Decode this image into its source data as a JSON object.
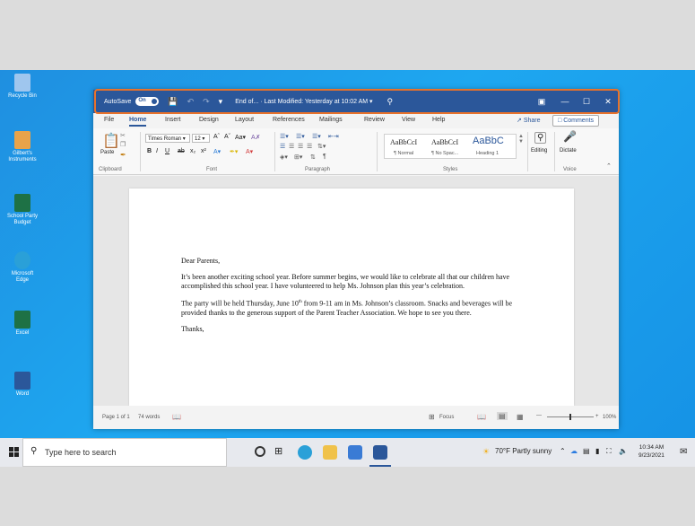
{
  "desktop": {
    "icons": [
      {
        "label": "Recycle Bin",
        "color": "#6aa7e8"
      },
      {
        "label": "Gilbert's Instruments",
        "color": "#e8a34a"
      },
      {
        "label": "School Party Budget",
        "color": "#1e7145"
      },
      {
        "label": "Microsoft Edge",
        "color": "#2aa0d8"
      },
      {
        "label": "Excel",
        "color": "#1e7145"
      },
      {
        "label": "Word",
        "color": "#2b579a"
      }
    ]
  },
  "titlebar": {
    "autosave": "AutoSave",
    "toggle": "On",
    "doc_title": "End of... · Last Modified: Yesterday at 10:02 AM ▾",
    "search_icon": "search-icon",
    "minimize": "—",
    "maximize": "☐",
    "close": "✕"
  },
  "tabs": {
    "items": [
      "File",
      "Home",
      "Insert",
      "Design",
      "Layout",
      "References",
      "Mailings",
      "Review",
      "View",
      "Help"
    ],
    "active": "Home",
    "share": "Share",
    "comments": "Comments"
  },
  "ribbon": {
    "clipboard": {
      "paste": "Paste",
      "group": "Clipboard"
    },
    "font": {
      "name": "Times Roman",
      "size": "12",
      "group": "Font"
    },
    "paragraph": {
      "group": "Paragraph"
    },
    "styles": {
      "group": "Styles",
      "items": [
        {
          "preview": "AaBbCcI",
          "label": "¶ Normal"
        },
        {
          "preview": "AaBbCcI",
          "label": "¶ No Spac..."
        },
        {
          "preview": "AaBbC",
          "label": "Heading 1"
        }
      ]
    },
    "editing": "Editing",
    "dictate": "Dictate",
    "voice_group": "Voice"
  },
  "document": {
    "greeting": "Dear Parents,",
    "para1": "It’s been another exciting school year. Before summer begins, we would like to celebrate all that our children have accomplished this school year. I have volunteered to help Ms. Johnson plan this year’s celebration.",
    "para2_a": "The party will be held Thursday, June 10",
    "para2_sup": "th",
    "para2_b": " from 9-11 am in Ms. Johnson’s classroom. Snacks and beverages will be provided thanks to the generous support of the Parent Teacher Association. We hope to see you there.",
    "closing": "Thanks,"
  },
  "statusbar": {
    "page": "Page 1 of 1",
    "words": "74 words",
    "focus": "Focus",
    "zoom_percent": 100,
    "zoom": "100%"
  },
  "taskbar": {
    "search_placeholder": "Type here to search",
    "weather": "70°F  Partly sunny",
    "time": "10:34 AM",
    "date": "9/23/2021"
  },
  "colors": {
    "word_blue": "#2b579a",
    "highlight": "#e8722b",
    "desktop": "#1ea7f0"
  }
}
